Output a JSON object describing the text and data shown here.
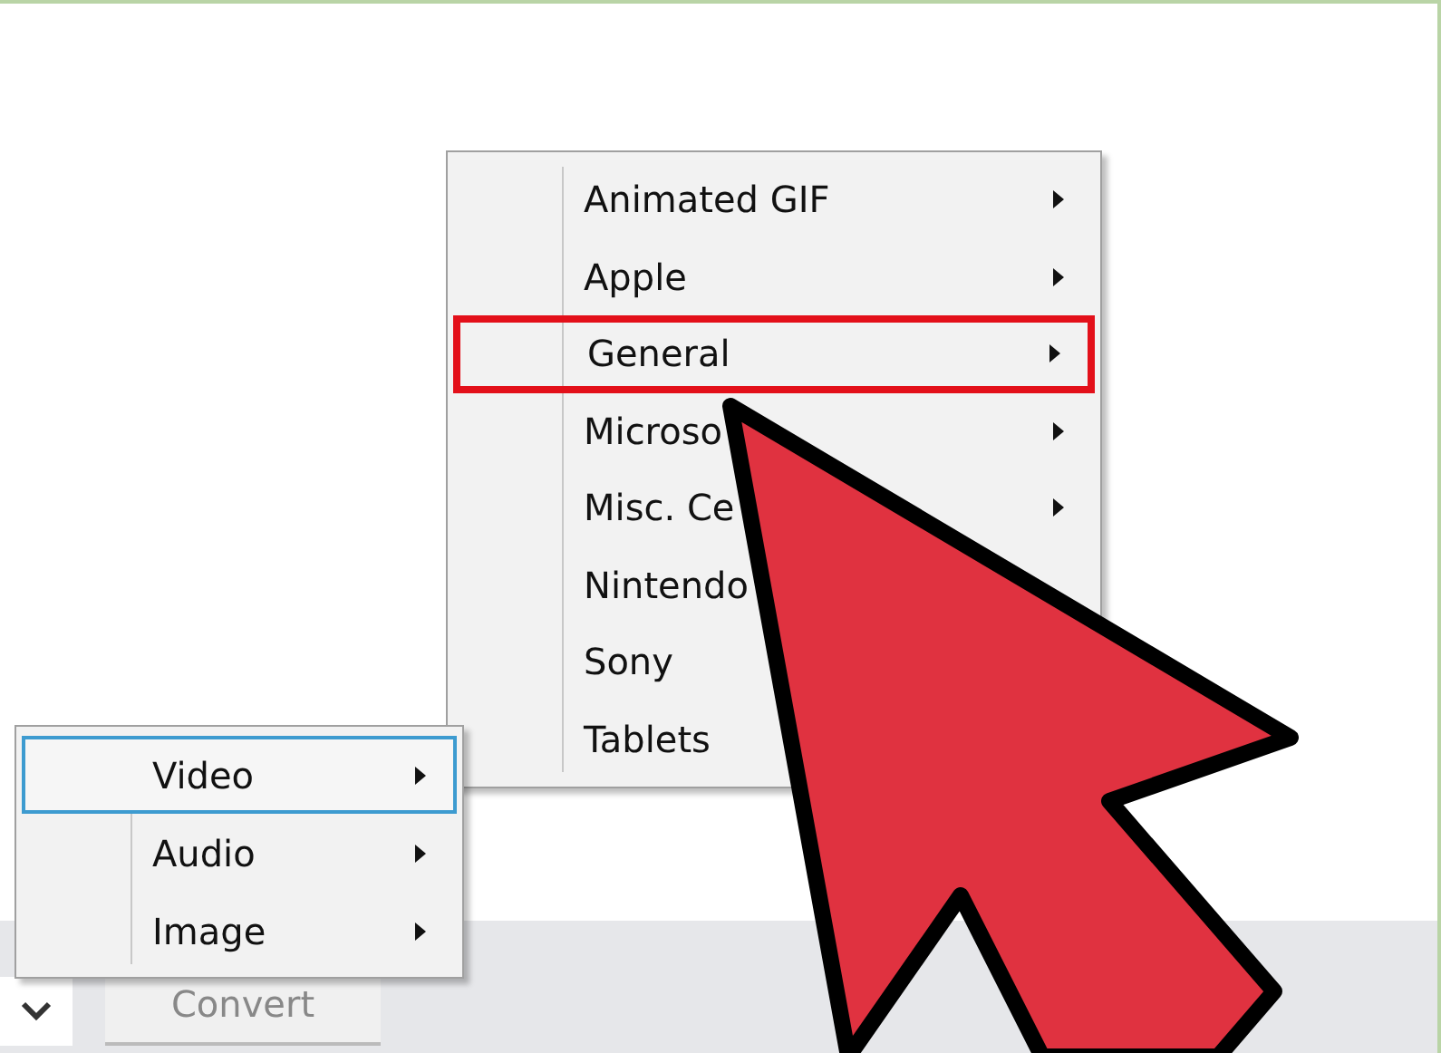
{
  "format_menu": {
    "items": [
      {
        "label": "Animated GIF",
        "submenu": true,
        "highlighted": false
      },
      {
        "label": "Apple",
        "submenu": true,
        "highlighted": false
      },
      {
        "label": "General",
        "submenu": true,
        "highlighted": true
      },
      {
        "label": "Microso",
        "submenu": true,
        "highlighted": false
      },
      {
        "label": "Misc. Ce",
        "submenu": true,
        "highlighted": false
      },
      {
        "label": "Nintendo",
        "submenu": false,
        "highlighted": false
      },
      {
        "label": "Sony",
        "submenu": false,
        "highlighted": false
      },
      {
        "label": "Tablets",
        "submenu": false,
        "highlighted": false
      }
    ]
  },
  "type_menu": {
    "items": [
      {
        "label": "Video",
        "submenu": true,
        "selected": true
      },
      {
        "label": "Audio",
        "submenu": true,
        "selected": false
      },
      {
        "label": "Image",
        "submenu": true,
        "selected": false
      }
    ]
  },
  "convert_button": {
    "label": "Convert"
  }
}
